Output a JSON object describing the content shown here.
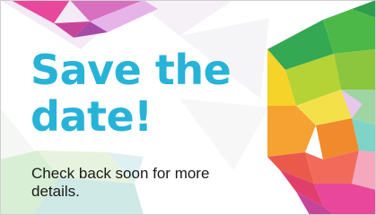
{
  "banner": {
    "headline": "Save the date!",
    "details": "Check back soon for more details."
  },
  "colors": {
    "headline": "#27b3d8",
    "details": "#1a1a1a",
    "background": "#ffffff",
    "facet_pink": "#e8479c",
    "facet_magenta": "#c7449b",
    "facet_green": "#34a853",
    "facet_lime": "#8cc63f",
    "facet_yellow": "#f6d328",
    "facet_orange": "#f08a2c",
    "facet_red": "#ea5a4a",
    "facet_teal": "#7fd3c7",
    "facet_lavender": "#e9c6ee"
  },
  "art": {
    "icon": "faceted-gem-decoration"
  }
}
